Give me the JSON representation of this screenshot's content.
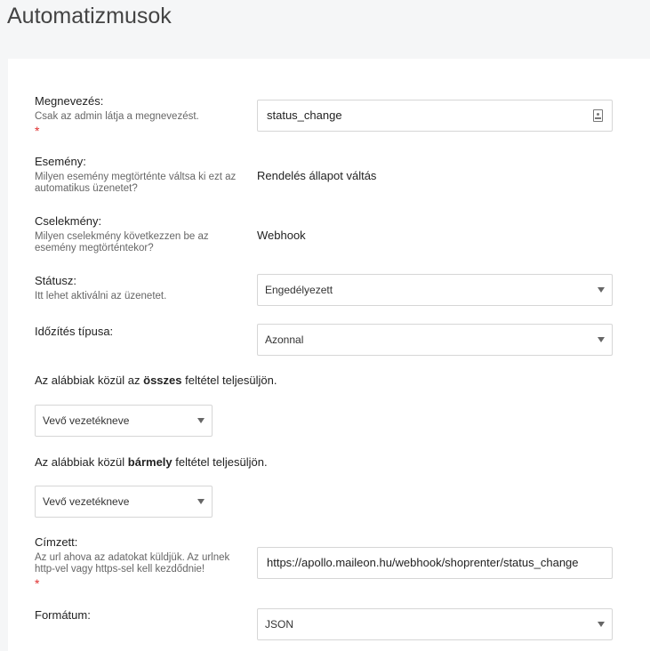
{
  "page": {
    "title": "Automatizmusok"
  },
  "fields": {
    "name": {
      "label": "Megnevezés:",
      "hint": "Csak az admin látja a megnevezést.",
      "required_mark": "*",
      "value": "status_change"
    },
    "event": {
      "label": "Esemény:",
      "hint": "Milyen esemény megtörténte váltsa ki ezt az automatikus üzenetet?",
      "value": "Rendelés állapot váltás"
    },
    "action": {
      "label": "Cselekmény:",
      "hint": "Milyen cselekmény következzen be az esemény megtörténtekor?",
      "value": "Webhook"
    },
    "status": {
      "label": "Státusz:",
      "hint": "Itt lehet aktiválni az üzenetet.",
      "value": "Engedélyezett"
    },
    "timing": {
      "label": "Időzítés típusa:",
      "value": "Azonnal"
    },
    "conditions_all": {
      "prefix": "Az alábbiak közül az ",
      "emph": "összes",
      "suffix": " feltétel teljesüljön.",
      "select_value": "Vevő vezetékneve"
    },
    "conditions_any": {
      "prefix": "Az alábbiak közül ",
      "emph": "bármely",
      "suffix": " feltétel teljesüljön.",
      "select_value": "Vevő vezetékneve"
    },
    "recipient": {
      "label": "Címzett:",
      "hint": "Az url ahova az adatokat küldjük. Az urlnek http-vel vagy https-sel kell kezdődnie!",
      "required_mark": "*",
      "value": "https://apollo.maileon.hu/webhook/shoprenter/status_change"
    },
    "format": {
      "label": "Formátum:",
      "value": "JSON"
    }
  }
}
